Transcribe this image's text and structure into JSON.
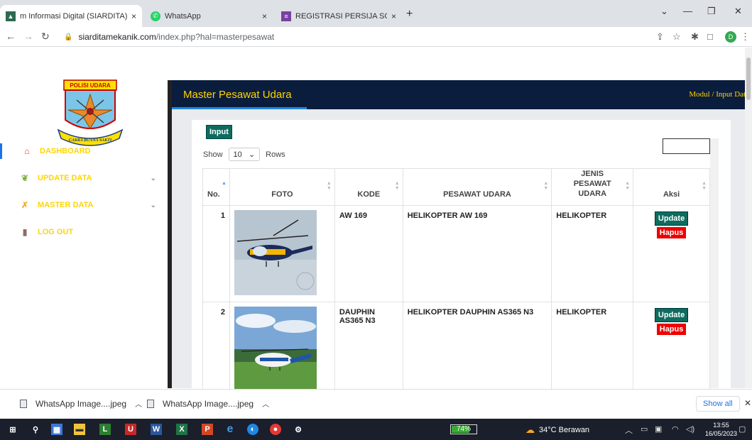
{
  "browser": {
    "tabs": [
      {
        "label": "m Informasi Digital (SIARDITA) M",
        "close": "×"
      },
      {
        "label": "WhatsApp",
        "close": "×"
      },
      {
        "label": "REGISTRASI PERSIJA SOCCER SCI",
        "close": "×"
      }
    ],
    "new_tab": "+",
    "url_host": "siarditamekanik.com",
    "url_path": "/index.php?hal=masterpesawat",
    "profile_initial": "D"
  },
  "sidebar": {
    "logo_text_top": "POLISI UDARA",
    "logo_text_bottom": "CAKRA BUANA SAKTI",
    "items": [
      {
        "label": "DASHBOARD",
        "icon": "home-icon"
      },
      {
        "label": "UPDATE DATA",
        "icon": "leaf-icon"
      },
      {
        "label": "MASTER DATA",
        "icon": "cross-icon"
      },
      {
        "label": "LOG OUT",
        "icon": "door-icon"
      }
    ]
  },
  "header": {
    "title": "Master Pesawat Udara",
    "breadcrumb": "Modul  /  Input Data"
  },
  "controls": {
    "input_button": "Input",
    "show_label": "Show",
    "show_value": "10",
    "rows_label": "Rows"
  },
  "table": {
    "columns": [
      "No.",
      "FOTO",
      "KODE",
      "PESAWAT UDARA",
      "JENIS PESAWAT UDARA",
      "Aksi"
    ],
    "rows": [
      {
        "no": "1",
        "kode": "AW 169",
        "pesawat": "HELIKOPTER AW 169",
        "jenis": "HELIKOPTER",
        "update": "Update",
        "hapus": "Hapus"
      },
      {
        "no": "2",
        "kode": "DAUPHIN AS365 N3",
        "pesawat": "HELIKOPTER DAUPHIN AS365 N3",
        "jenis": "HELIKOPTER",
        "update": "Update",
        "hapus": "Hapus"
      }
    ]
  },
  "downloads": {
    "items": [
      "WhatsApp Image....jpeg",
      "WhatsApp Image....jpeg"
    ],
    "show_all": "Show all"
  },
  "taskbar": {
    "battery": "74%",
    "battery_level": 0.74,
    "weather": "34°C  Berawan",
    "time": "13:55",
    "date": "16/05/2023"
  },
  "colors": {
    "accent_yellow": "#ffd500",
    "header_navy": "#0b1d3d",
    "btn_green": "#0e6c5f",
    "btn_red": "#e00000"
  }
}
